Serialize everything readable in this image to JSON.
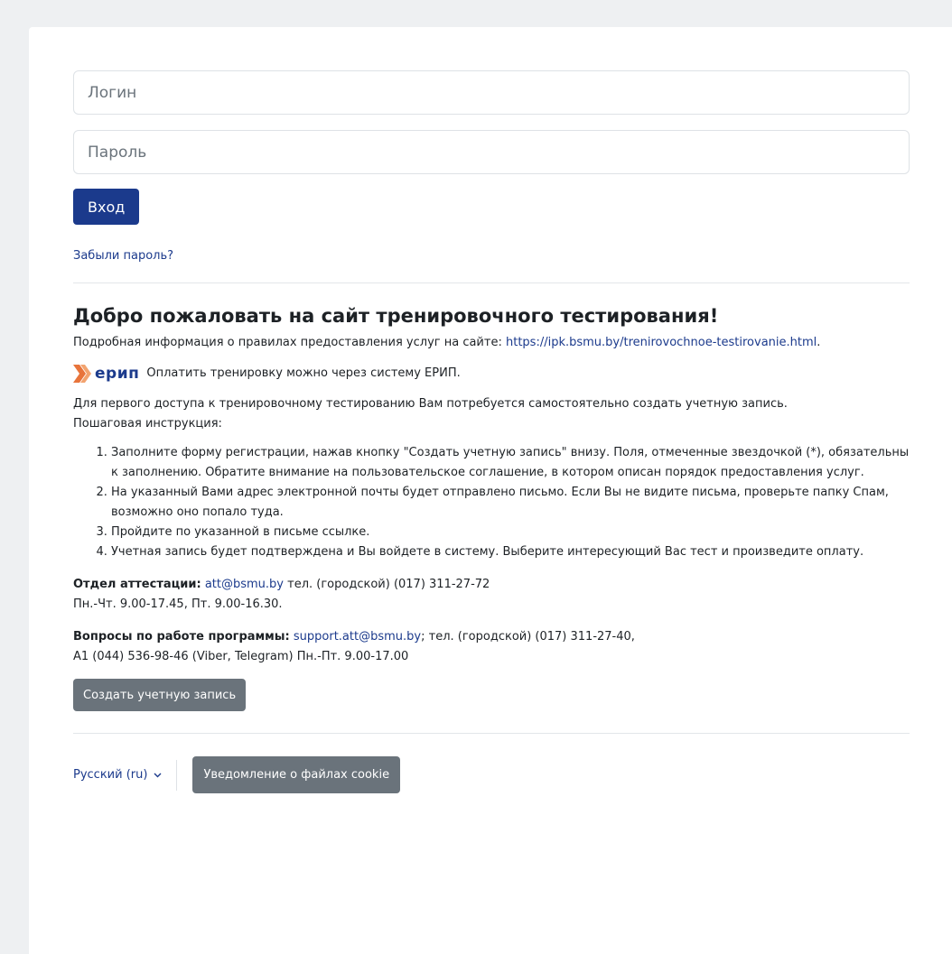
{
  "login_form": {
    "login_placeholder": "Логин",
    "password_placeholder": "Пароль",
    "submit_label": "Вход",
    "forgot_label": "Забыли пароль?"
  },
  "welcome": {
    "title": "Добро пожаловать на сайт тренировочного тестирования!",
    "info_prefix": "Подробная информация о правилах предоставления услуг на сайте:",
    "info_link": "https://ipk.bsmu.by/trenirovochnoe-testirovanie.html",
    "info_suffix": ".",
    "erip_logo_text": "ерип",
    "erip_text": "Оплатить тренировку можно через систему ЕРИП.",
    "intro_line1": "Для первого доступа к тренировочному тестированию Вам потребуется самостоятельно создать учетную запись.",
    "intro_line2": "Пошаговая инструкция:",
    "steps": [
      "Заполните форму регистрации, нажав кнопку \"Создать учетную запись\" внизу. Поля, отмеченные звездочкой (*), обязательны к заполнению. Обратите внимание на пользовательское соглашение, в котором описан порядок предоставления услуг.",
      "На указанный Вами адрес электронной почты будет отправлено письмо. Если Вы не видите письма, проверьте папку Спам, возможно оно попало туда.",
      "Пройдите по указанной в письме ссылке.",
      "Учетная запись будет подтверждена и Вы войдете в систему. Выберите интересующий Вас тест и произведите оплату."
    ]
  },
  "attestation": {
    "label": "Отдел аттестации:",
    "email": "att@bsmu.by",
    "phone": "тел. (городской) (017) 311-27-72",
    "hours": "Пн.-Чт. 9.00-17.45, Пт. 9.00-16.30."
  },
  "support": {
    "label": "Вопросы по работе программы:",
    "email": "support.att@bsmu.by",
    "phone": "; тел. (городской) (017) 311-27-40,",
    "line2": "А1 (044) 536-98-46 (Viber, Telegram) Пн.-Пт. 9.00-17.00"
  },
  "create_account_label": "Создать учетную запись",
  "footer": {
    "language": "Русский (ru)",
    "cookie_label": "Уведомление о файлах cookie"
  },
  "colors": {
    "primary": "#1b3a8c",
    "secondary": "#6a737b",
    "erip_orange": "#e8743b"
  }
}
